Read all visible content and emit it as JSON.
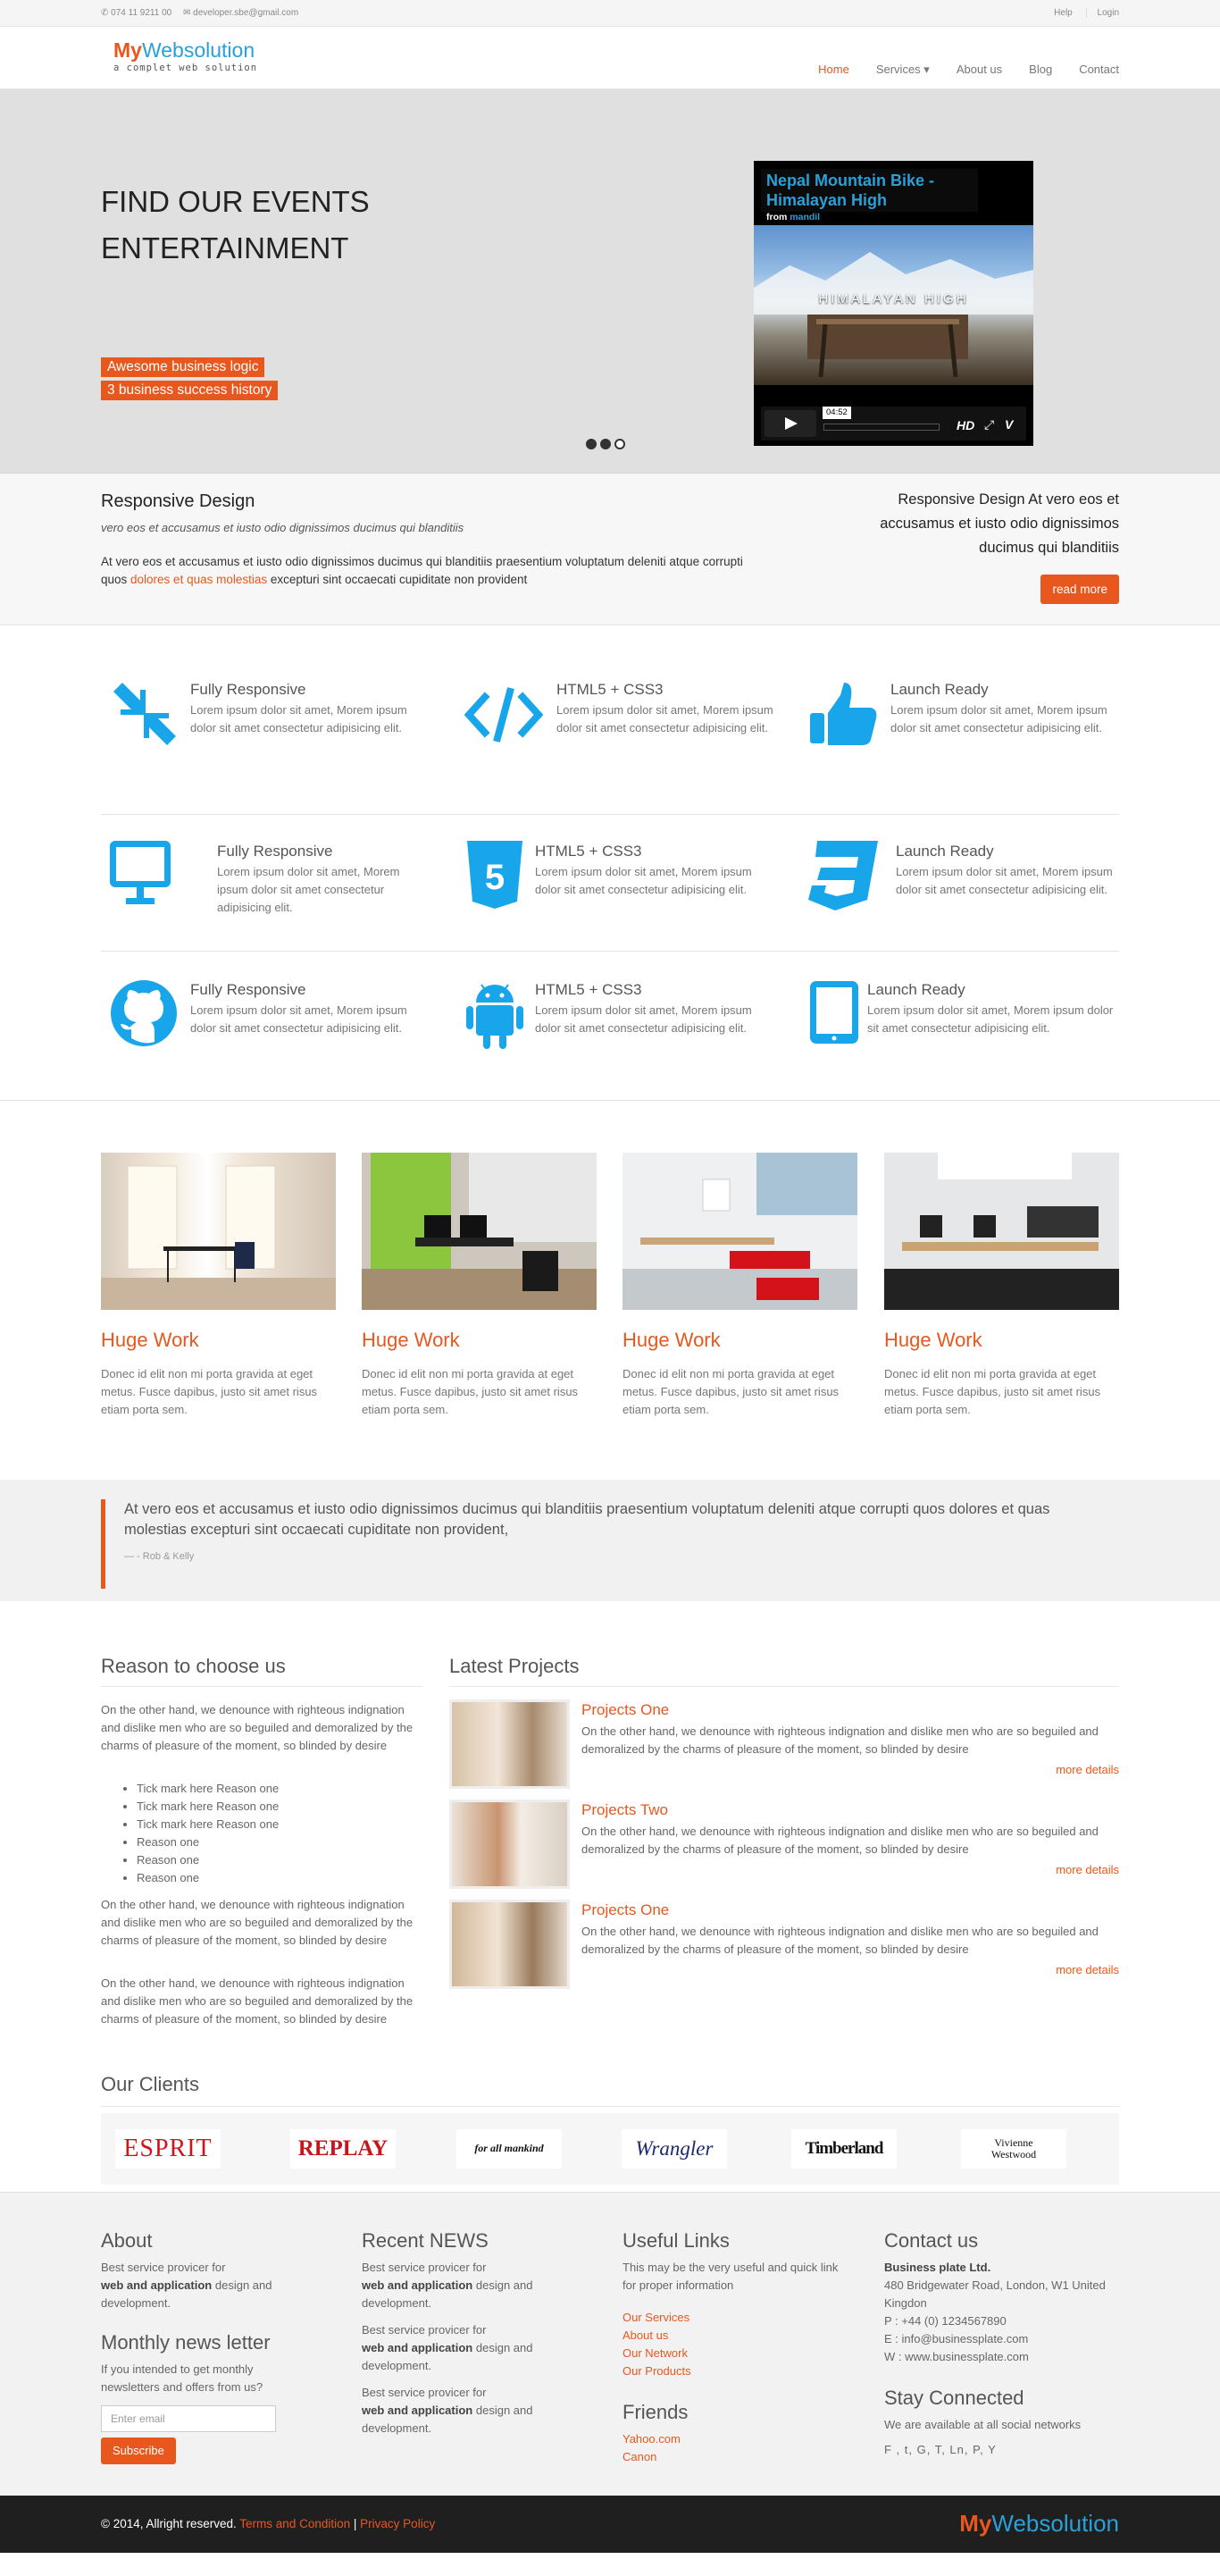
{
  "topbar": {
    "phone": "074 11 9211 00",
    "email": "developer.sbe@gmail.com",
    "help": "Help",
    "login": "Login"
  },
  "logo": {
    "my": "My",
    "brand": "Websolution",
    "tagline": "a complet web solution"
  },
  "nav": {
    "items": [
      "Home",
      "Services ▾",
      "About us",
      "Blog",
      "Contact"
    ],
    "active": "Home"
  },
  "hero": {
    "title": "FIND OUR EVENTS ENTERTAINMENT",
    "tags": [
      "Awesome business logic",
      "3 business success history"
    ],
    "video": {
      "title": "Nepal Mountain Bike - Himalayan High",
      "from": "from",
      "author": "mandil",
      "overlay": "HIMALAYAN HIGH",
      "time": "04:52",
      "hd": "HD"
    },
    "slide_count": 3,
    "active_slide": 2
  },
  "intro": {
    "title": "Responsive Design",
    "subtitle": "vero eos et accusamus et iusto odio dignissimos ducimus qui blanditiis",
    "text_before": "At vero eos et accusamus et iusto odio dignissimos ducimus qui blanditiis praesentium voluptatum deleniti atque corrupti quos ",
    "link": "dolores et quas molestias",
    "text_after": " excepturi sint occaecati cupiditate non provident",
    "right_text": "Responsive Design At vero eos et accusamus et iusto odio dignissimos ducimus qui blanditiis",
    "button": "read more"
  },
  "features": [
    [
      {
        "icon": "compress-icon",
        "title": "Fully Responsive",
        "text": "Lorem ipsum dolor sit amet, Morem ipsum dolor sit amet consectetur adipisicing elit."
      },
      {
        "icon": "code-icon",
        "title": "HTML5 + CSS3",
        "text": "Lorem ipsum dolor sit amet, Morem ipsum dolor sit amet consectetur adipisicing elit."
      },
      {
        "icon": "thumbs-up-icon",
        "title": "Launch Ready",
        "text": "Lorem ipsum dolor sit amet, Morem ipsum dolor sit amet consectetur adipisicing elit."
      }
    ],
    [
      {
        "icon": "desktop-icon",
        "title": "Fully Responsive",
        "text": "Lorem ipsum dolor sit amet, Morem ipsum dolor sit amet consectetur adipisicing elit."
      },
      {
        "icon": "html5-icon",
        "title": "HTML5 + CSS3",
        "text": "Lorem ipsum dolor sit amet, Morem ipsum dolor sit amet consectetur adipisicing elit."
      },
      {
        "icon": "css3-icon",
        "title": "Launch Ready",
        "text": "Lorem ipsum dolor sit amet, Morem ipsum dolor sit amet consectetur adipisicing elit."
      }
    ],
    [
      {
        "icon": "github-icon",
        "title": "Fully Responsive",
        "text": "Lorem ipsum dolor sit amet, Morem ipsum dolor sit amet consectetur adipisicing elit."
      },
      {
        "icon": "android-icon",
        "title": "HTML5 + CSS3",
        "text": "Lorem ipsum dolor sit amet, Morem ipsum dolor sit amet consectetur adipisicing elit."
      },
      {
        "icon": "tablet-icon",
        "title": "Launch Ready",
        "text": "Lorem ipsum dolor sit amet, Morem ipsum dolor sit amet consectetur adipisicing elit."
      }
    ]
  ],
  "works": [
    {
      "title": "Huge Work",
      "text": "Donec id elit non mi porta gravida at eget metus. Fusce dapibus, justo sit amet risus etiam porta sem."
    },
    {
      "title": "Huge Work",
      "text": "Donec id elit non mi porta gravida at eget metus. Fusce dapibus, justo sit amet risus etiam porta sem."
    },
    {
      "title": "Huge Work",
      "text": "Donec id elit non mi porta gravida at eget metus. Fusce dapibus, justo sit amet risus etiam porta sem."
    },
    {
      "title": "Huge Work",
      "text": "Donec id elit non mi porta gravida at eget metus. Fusce dapibus, justo sit amet risus etiam porta sem."
    }
  ],
  "quote": {
    "text": "At vero eos et accusamus et iusto odio dignissimos ducimus qui blanditiis praesentium voluptatum deleniti atque corrupti quos dolores et quas molestias excepturi sint occaecati cupiditate non provident,",
    "author": "— - Rob & Kelly"
  },
  "reason": {
    "title": "Reason to choose us",
    "p1": "On the other hand, we denounce with righteous indignation and dislike men who are so beguiled and demoralized by the charms of pleasure of the moment, so blinded by desire",
    "list": [
      "Tick mark here Reason one",
      "Tick mark here Reason one",
      "Tick mark here Reason one",
      "Reason one",
      "Reason one",
      "Reason one"
    ],
    "p2": "On the other hand, we denounce with righteous indignation and dislike men who are so beguiled and demoralized by the charms of pleasure of the moment, so blinded by desire",
    "p3": "On the other hand, we denounce with righteous indignation and dislike men who are so beguiled and demoralized by the charms of pleasure of the moment, so blinded by desire"
  },
  "projects": {
    "title": "Latest Projects",
    "items": [
      {
        "title": "Projects One",
        "text": "On the other hand, we denounce with righteous indignation and dislike men who are so beguiled and demoralized by the charms of pleasure of the moment, so blinded by desire",
        "link": "more details"
      },
      {
        "title": "Projects Two",
        "text": "On the other hand, we denounce with righteous indignation and dislike men who are so beguiled and demoralized by the charms of pleasure of the moment, so blinded by desire",
        "link": "more details"
      },
      {
        "title": "Projects One",
        "text": "On the other hand, we denounce with righteous indignation and dislike men who are so beguiled and demoralized by the charms of pleasure of the moment, so blinded by desire",
        "link": "more details"
      }
    ]
  },
  "clients": {
    "title": "Our Clients",
    "logos": [
      "ESPRIT",
      "REPLAY",
      "for all mankind",
      "Wrangler",
      "Timberland",
      "Vivienne Westwood"
    ]
  },
  "footer": {
    "about": {
      "title": "About",
      "pre": "Best service provicer for",
      "bold": "web and application",
      "post": " design and development."
    },
    "newsletter": {
      "title": "Monthly news letter",
      "text": "If you intended to get monthly newsletters and offers from us?",
      "placeholder": "Enter email",
      "button": "Subscribe"
    },
    "news": {
      "title": "Recent NEWS",
      "items": [
        {
          "pre": "Best service provicer for",
          "bold": "web and application",
          "post": " design and development."
        },
        {
          "pre": "Best service provicer for",
          "bold": "web and application",
          "post": " design and development."
        },
        {
          "pre": "Best service provicer for",
          "bold": "web and application",
          "post": " design and development."
        }
      ]
    },
    "links": {
      "title": "Useful Links",
      "text": "This may be the very useful and quick link for proper information",
      "items": [
        "Our Services",
        "About us",
        "Our Network",
        "Our Products"
      ]
    },
    "friends": {
      "title": "Friends",
      "items": [
        "Yahoo.com",
        "Canon"
      ]
    },
    "contact": {
      "title": "Contact us",
      "company": "Business plate Ltd.",
      "address": "480 Bridgewater Road, London, W1 United Kingdon",
      "phone": "P : +44 (0) 1234567890",
      "email": "E : info@businessplate.com",
      "web": "W : www.businessplate.com"
    },
    "social": {
      "title": "Stay Connected",
      "text": "We are available at all social networks",
      "icons": "F , t, G, T, Ln, P, Y"
    }
  },
  "bottom": {
    "copy": "© 2014, Allright reserved.",
    "terms": "Terms and Condition",
    "sep": "|",
    "privacy": "Privacy Policy"
  },
  "colors": {
    "accent": "#e8571e",
    "blue": "#29a0d8"
  }
}
